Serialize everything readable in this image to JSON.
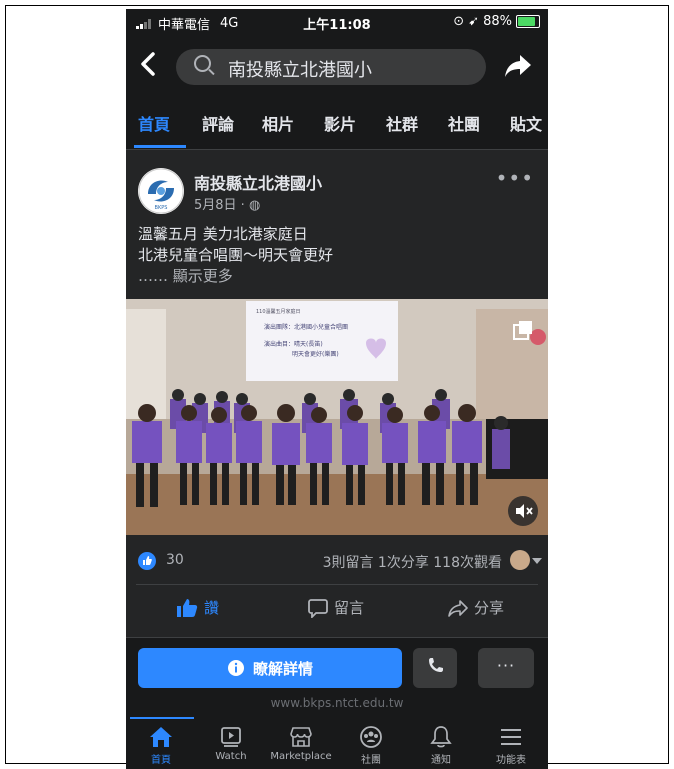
{
  "status": {
    "carrier": "中華電信",
    "network": "4G",
    "time": "上午11:08",
    "battery": "88%"
  },
  "search": {
    "query": "南投縣立北港國小"
  },
  "tabs": [
    "首頁",
    "評論",
    "相片",
    "影片",
    "社群",
    "社團",
    "貼文"
  ],
  "post": {
    "page_name": "南投縣立北港國小",
    "date": "5月8日 · ",
    "line1": "溫馨五月 美力北港家庭日",
    "line2": "北港兒童合唱團～明天會更好",
    "see_more": "…… 顯示更多",
    "slide_line1": "演出團隊：北港國小兒童合唱團",
    "slide_line2": "演出曲目：晴天(長笛)",
    "slide_line3": "明天會更好(樂團)",
    "slide_title": "110溫馨五月家庭日"
  },
  "counts": {
    "likes": "30",
    "stats": "3則留言  1次分享  118次觀看"
  },
  "actions": {
    "like": "讚",
    "comment": "留言",
    "share": "分享"
  },
  "cta": {
    "learn_more": "瞭解詳情",
    "website": "www.bkps.ntct.edu.tw",
    "more": "···"
  },
  "nav": [
    {
      "label": "首頁",
      "icon": "home-icon"
    },
    {
      "label": "Watch",
      "icon": "watch-icon"
    },
    {
      "label": "Marketplace",
      "icon": "marketplace-icon"
    },
    {
      "label": "社團",
      "icon": "groups-icon"
    },
    {
      "label": "通知",
      "icon": "bell-icon"
    },
    {
      "label": "功能表",
      "icon": "menu-icon"
    }
  ],
  "colors": {
    "accent": "#2d88ff",
    "background": "#242526",
    "bar": "#18191a"
  }
}
